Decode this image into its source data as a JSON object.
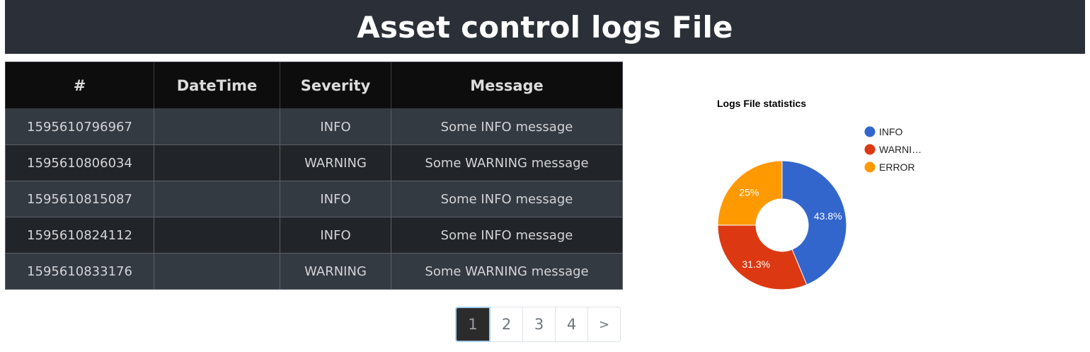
{
  "header": {
    "title": "Asset control logs File"
  },
  "table": {
    "columns": [
      "#",
      "DateTime",
      "Severity",
      "Message"
    ],
    "rows": [
      {
        "id": "1595610796967",
        "datetime": "",
        "severity": "INFO",
        "message": "Some INFO message"
      },
      {
        "id": "1595610806034",
        "datetime": "",
        "severity": "WARNING",
        "message": "Some WARNING message"
      },
      {
        "id": "1595610815087",
        "datetime": "",
        "severity": "INFO",
        "message": "Some INFO message"
      },
      {
        "id": "1595610824112",
        "datetime": "",
        "severity": "INFO",
        "message": "Some INFO message"
      },
      {
        "id": "1595610833176",
        "datetime": "",
        "severity": "WARNING",
        "message": "Some WARNING message"
      }
    ]
  },
  "pagination": {
    "pages": [
      "1",
      "2",
      "3",
      "4"
    ],
    "active": "1",
    "next_label": ">"
  },
  "chart_data": {
    "type": "pie",
    "donut": true,
    "title": "Logs File statistics",
    "legend_position": "right",
    "categories": [
      "INFO",
      "WARNING",
      "ERROR"
    ],
    "legend_labels": [
      "INFO",
      "WARNI…",
      "ERROR"
    ],
    "values": [
      43.8,
      31.3,
      25
    ],
    "labels": [
      "43.8%",
      "31.3%",
      "25%"
    ],
    "colors": [
      "#3366cc",
      "#dc3912",
      "#ff9900"
    ]
  }
}
